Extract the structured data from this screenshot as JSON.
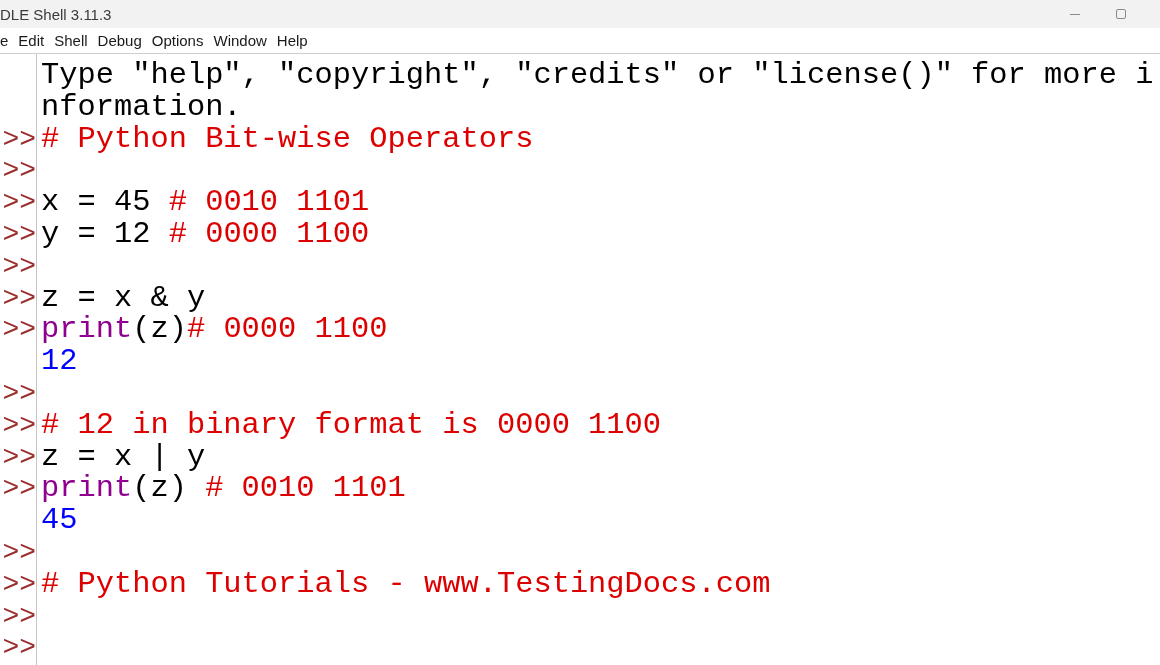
{
  "window": {
    "title": "DLE Shell 3.11.3"
  },
  "menu_bar": [
    "e",
    "Edit",
    "Shell",
    "Debug",
    "Options",
    "Window",
    "Help"
  ],
  "shell": {
    "lines": [
      {
        "segments": [
          {
            "kind": "text",
            "text": "Type \"help\", \"copyright\", \"credits\" or \"license()\" for more i"
          }
        ]
      },
      {
        "segments": [
          {
            "kind": "text",
            "text": "nformation."
          }
        ]
      },
      {
        "prompt": ">>",
        "segments": [
          {
            "kind": "comment",
            "text": "# Python Bit-wise Operators"
          }
        ]
      },
      {
        "prompt": ">>"
      },
      {
        "prompt": ">>",
        "segments": [
          {
            "kind": "code",
            "text": "x = 45 "
          },
          {
            "kind": "comment",
            "text": "# 0010 1101"
          }
        ]
      },
      {
        "prompt": ">>",
        "segments": [
          {
            "kind": "code",
            "text": "y = 12 "
          },
          {
            "kind": "comment",
            "text": "# 0000 1100"
          }
        ]
      },
      {
        "prompt": ">>"
      },
      {
        "prompt": ">>",
        "segments": [
          {
            "kind": "code",
            "text": "z = x & y"
          }
        ]
      },
      {
        "prompt": ">>",
        "segments": [
          {
            "kind": "builtin",
            "text": "print"
          },
          {
            "kind": "code",
            "text": "(z)"
          },
          {
            "kind": "comment",
            "text": "# 0000 1100"
          }
        ]
      },
      {
        "segments": [
          {
            "kind": "output",
            "text": "12"
          }
        ]
      },
      {
        "prompt": ">>"
      },
      {
        "prompt": ">>",
        "segments": [
          {
            "kind": "comment",
            "text": "# 12 in binary format is 0000 1100"
          }
        ]
      },
      {
        "prompt": ">>",
        "segments": [
          {
            "kind": "code",
            "text": "z = x | y"
          }
        ]
      },
      {
        "prompt": ">>",
        "segments": [
          {
            "kind": "builtin",
            "text": "print"
          },
          {
            "kind": "code",
            "text": "(z) "
          },
          {
            "kind": "comment",
            "text": "# 0010 1101"
          }
        ]
      },
      {
        "segments": [
          {
            "kind": "output",
            "text": "45"
          }
        ]
      },
      {
        "prompt": ">>"
      },
      {
        "prompt": ">>",
        "segments": [
          {
            "kind": "comment",
            "text": "# Python Tutorials - www.TestingDocs.com"
          }
        ]
      },
      {
        "prompt": ">>"
      },
      {
        "prompt": ">>"
      }
    ]
  }
}
